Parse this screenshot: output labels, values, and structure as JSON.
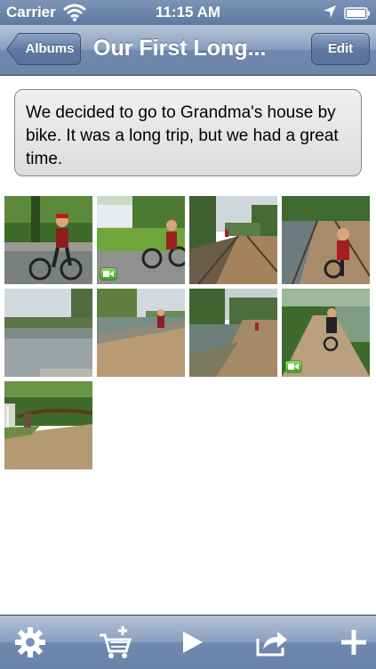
{
  "status_bar": {
    "carrier": "Carrier",
    "time": "11:15 AM",
    "icons": [
      "wifi-icon",
      "location-arrow-icon",
      "battery-icon"
    ]
  },
  "nav": {
    "back_label": "Albums",
    "title": "Our First Long...",
    "edit_label": "Edit"
  },
  "album": {
    "description": "We decided to go to Grandma's house by bike. It was a long trip, but we had a great time.",
    "photos": [
      {
        "scene": "child on bike by stone wall",
        "video": false
      },
      {
        "scene": "child riding bike on lawn",
        "video": true
      },
      {
        "scene": "wooden boardwalk bridge",
        "video": false
      },
      {
        "scene": "child with bike on boardwalk",
        "video": false
      },
      {
        "scene": "calm river",
        "video": false
      },
      {
        "scene": "canal path with child",
        "video": false
      },
      {
        "scene": "river towpath",
        "video": false
      },
      {
        "scene": "child biking on dirt trail",
        "video": true
      },
      {
        "scene": "dirt path under trees",
        "video": false
      }
    ]
  },
  "toolbar": {
    "buttons": [
      "settings-gear-icon",
      "add-to-cart-icon",
      "play-icon",
      "share-icon",
      "add-plus-icon"
    ]
  },
  "colors": {
    "bar_blue": "#6f88ad",
    "video_green": "#4cb82c"
  }
}
